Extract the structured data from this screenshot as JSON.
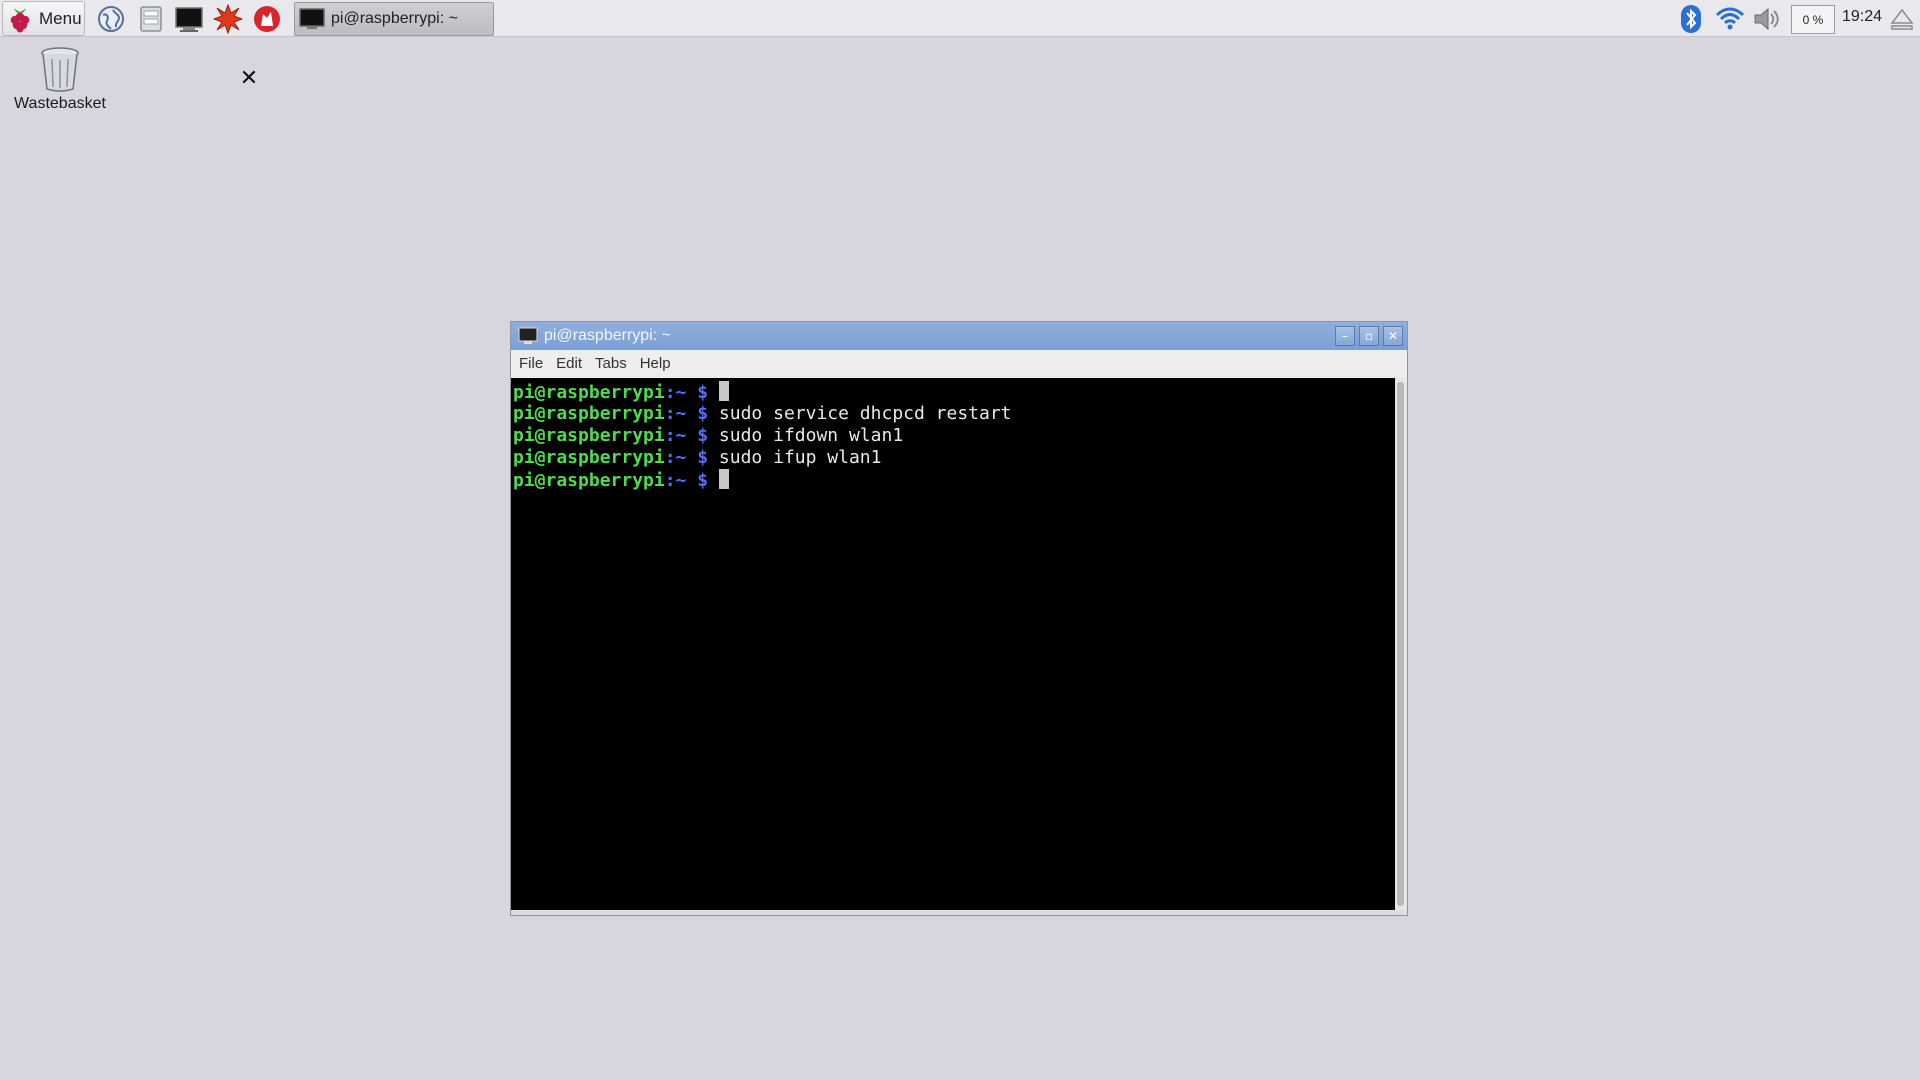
{
  "panel": {
    "menu_label": "Menu",
    "launchers": [
      {
        "name": "web-browser-icon"
      },
      {
        "name": "file-manager-icon"
      },
      {
        "name": "terminal-icon"
      },
      {
        "name": "mathematica-icon"
      },
      {
        "name": "wolfram-icon"
      }
    ],
    "task_label": "pi@raspberrypi: ~",
    "cpu_label": "0 %",
    "clock": "19:24"
  },
  "desktop": {
    "wastebasket_label": "Wastebasket"
  },
  "terminal": {
    "title": "pi@raspberrypi: ~",
    "menus": [
      "File",
      "Edit",
      "Tabs",
      "Help"
    ],
    "prompt_user": "pi@raspberrypi",
    "prompt_path": ":~ $",
    "lines": [
      {
        "command": ""
      },
      {
        "command": "sudo service dhcpcd restart"
      },
      {
        "command": "sudo ifdown wlan1"
      },
      {
        "command": "sudo ifup wlan1"
      },
      {
        "command": ""
      }
    ]
  },
  "colors": {
    "prompt_user": "#4fdb4f",
    "prompt_path": "#5c6cf0",
    "titlebar": "#7b9fd3",
    "desktop": "#d8d5df"
  }
}
